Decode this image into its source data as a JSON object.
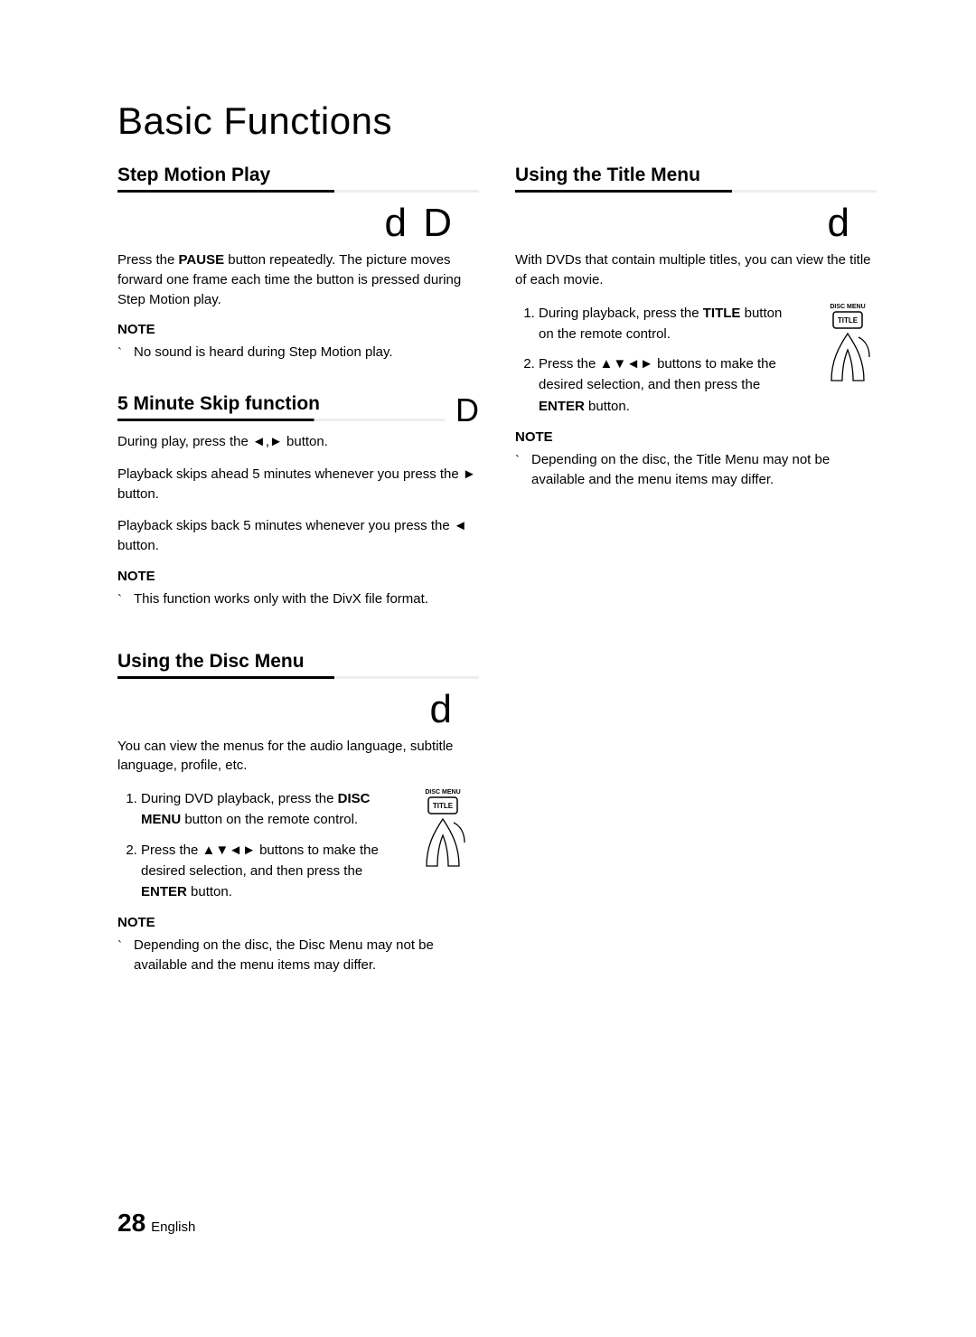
{
  "title": "Basic Functions",
  "stepMotion": {
    "heading": "Step Motion Play",
    "iconA": "d",
    "iconB": "D",
    "body": "Press the PAUSE button repeatedly. The picture moves forward one frame each time the button is pressed during Step Motion play.",
    "noteLabel": "NOTE",
    "note": "No sound is heard during Step Motion play."
  },
  "skip": {
    "heading": "5 Minute Skip function",
    "icon": "D",
    "line1a": "During play, press the ",
    "arrows": "◄,►",
    "line1b": " button.",
    "line2": "Playback skips ahead 5 minutes whenever you press the ► button.",
    "line3": "Playback skips back 5 minutes whenever you press the ◄ button.",
    "noteLabel": "NOTE",
    "note": "This function works only with the DivX file format."
  },
  "discMenu": {
    "heading": "Using the Disc Menu",
    "icon": "d",
    "intro": "You can view the menus for the audio language, subtitle language, profile, etc.",
    "step1a": "During DVD playback, press the ",
    "step1key": "DISC MENU",
    "step1b": " button on the remote control.",
    "step2a": "Press the ",
    "step2arrows": "▲▼◄►",
    "step2b": " buttons to make the desired selection, and then press the ",
    "step2key": "ENTER",
    "step2c": " button.",
    "noteLabel": "NOTE",
    "note": "Depending on the disc, the Disc Menu may not be available and the menu items may differ."
  },
  "titleMenu": {
    "heading": "Using the Title Menu",
    "icon": "d",
    "intro": "With DVDs that contain multiple titles, you can view the title of each movie.",
    "step1a": "During playback, press the ",
    "step1key": "TITLE",
    "step1b": " button on the remote control.",
    "step2a": "Press the ",
    "step2arrows": "▲▼◄►",
    "step2b": " buttons to make the desired selection, and then press the ",
    "step2key": "ENTER",
    "step2c": " button.",
    "noteLabel": "NOTE",
    "note": "Depending on the disc, the Title Menu may not be available and the menu items may differ."
  },
  "footer": {
    "pageNumber": "28",
    "lang": "English"
  },
  "remoteLabel": "TITLE",
  "remoteLabel2": "DISC MENU"
}
